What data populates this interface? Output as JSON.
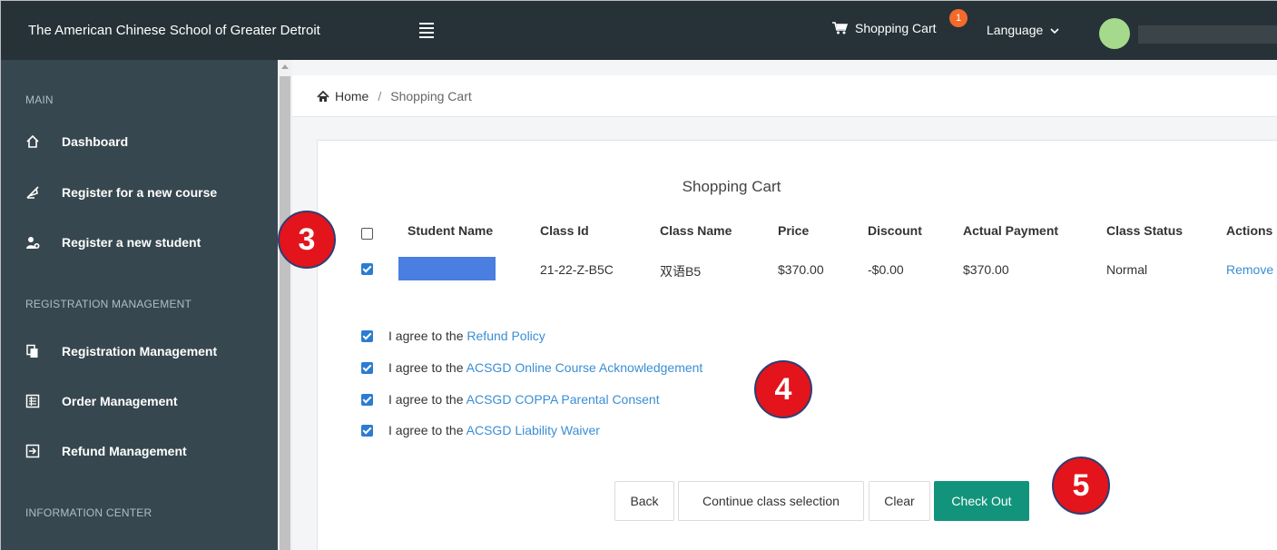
{
  "header": {
    "brand": "The American Chinese School of Greater Detroit",
    "cart_label": "Shopping Cart",
    "cart_badge": "1",
    "language_label": "Language"
  },
  "sidebar": {
    "sections": [
      {
        "label": "MAIN"
      },
      {
        "label": "REGISTRATION MANAGEMENT"
      },
      {
        "label": "INFORMATION CENTER"
      }
    ],
    "items": [
      {
        "label": "Dashboard",
        "icon": "home-icon"
      },
      {
        "label": "Register for a new course",
        "icon": "quill-icon"
      },
      {
        "label": "Register a new student",
        "icon": "user-add-icon"
      },
      {
        "label": "Registration Management",
        "icon": "copy-icon"
      },
      {
        "label": "Order Management",
        "icon": "list-icon"
      },
      {
        "label": "Refund Management",
        "icon": "sign-in-icon"
      }
    ]
  },
  "breadcrumb": {
    "home": "Home",
    "separator": "/",
    "current": "Shopping Cart"
  },
  "cart": {
    "title": "Shopping Cart",
    "columns": [
      "Student Name",
      "Class Id",
      "Class Name",
      "Price",
      "Discount",
      "Actual Payment",
      "Class Status",
      "Actions"
    ],
    "rows": [
      {
        "class_id": "21-22-Z-B5C",
        "class_name": "双语B5",
        "price": "$370.00",
        "discount": "-$0.00",
        "actual_payment": "$370.00",
        "class_status": "Normal",
        "action": "Remove"
      }
    ]
  },
  "agreements": [
    {
      "prefix": "I agree to the",
      "link": "Refund Policy"
    },
    {
      "prefix": "I agree to the",
      "link": "ACSGD Online Course Acknowledgement"
    },
    {
      "prefix": "I agree to the",
      "link": "ACSGD COPPA Parental Consent"
    },
    {
      "prefix": "I agree to the",
      "link": "ACSGD Liability Waiver"
    }
  ],
  "buttons": {
    "back": "Back",
    "continue": "Continue class selection",
    "clear": "Clear",
    "checkout": "Check Out"
  },
  "annotations": [
    "3",
    "4",
    "5"
  ],
  "colors": {
    "topbar": "#263238",
    "sidebar": "#37474f",
    "link": "#3a8ed4",
    "primary": "#12947c",
    "badge": "#f36a2a",
    "annotation": "#e3141b"
  }
}
